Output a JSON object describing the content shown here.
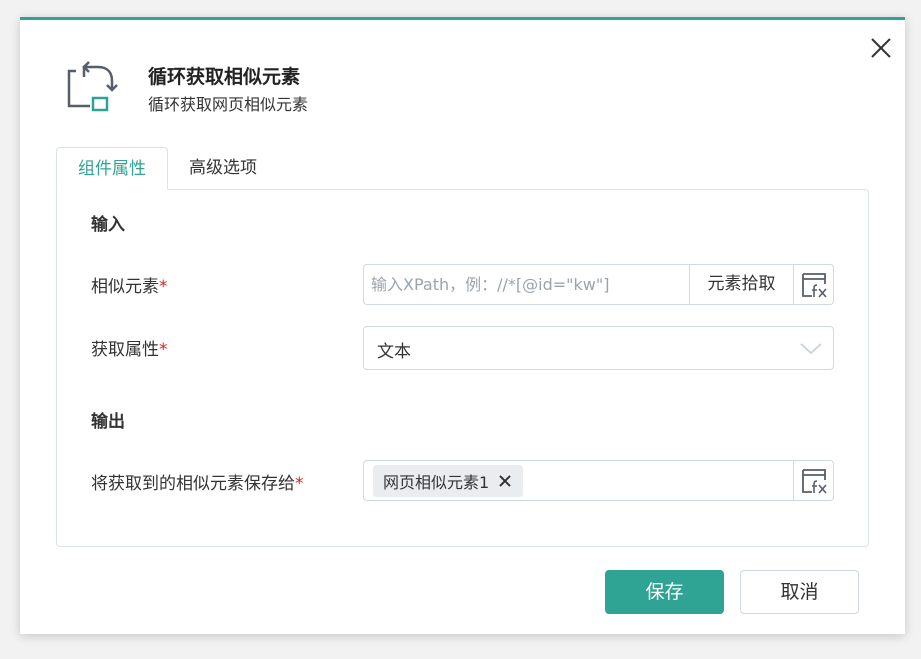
{
  "dialog": {
    "title": "循环获取相似元素",
    "subtitle": "循环获取网页相似元素",
    "accent_color": "#2fa394"
  },
  "tabs": [
    {
      "label": "组件属性",
      "active": true
    },
    {
      "label": "高级选项",
      "active": false
    }
  ],
  "input_section": {
    "title": "输入",
    "similar_element": {
      "label": "相似元素",
      "required_mark": "*",
      "placeholder": "输入XPath，例：//*[@id=\"kw\"]",
      "value": "",
      "pick_button": "元素拾取",
      "fx_icon": "fx-icon"
    },
    "get_attribute": {
      "label": "获取属性",
      "required_mark": "*",
      "selected": "文本",
      "chevron_icon": "chevron-down-icon"
    }
  },
  "output_section": {
    "title": "输出",
    "save_to": {
      "label": "将获取到的相似元素保存给",
      "required_mark": "*",
      "tag": "网页相似元素1",
      "fx_icon": "fx-icon"
    }
  },
  "footer": {
    "save_label": "保存",
    "cancel_label": "取消"
  }
}
